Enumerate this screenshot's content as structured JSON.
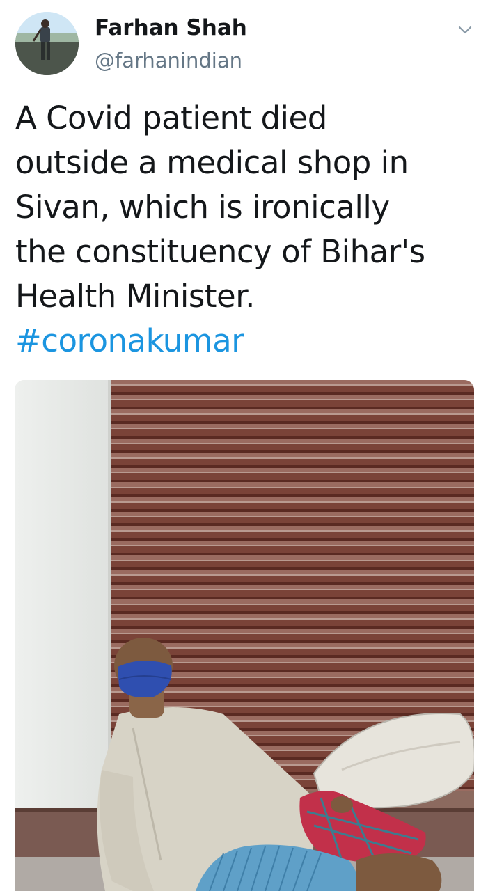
{
  "tweet": {
    "author": {
      "display_name": "Farhan Shah",
      "handle": "@farhanindian",
      "avatar_icon": "user-avatar"
    },
    "menu_icon": "chevron-down-icon",
    "text_lines": [
      "A Covid patient died",
      "outside a medical shop in",
      "Sivan, which is ironically",
      "the constituency of Bihar's",
      "Health Minister."
    ],
    "hashtag": "#coronakumar",
    "media": {
      "type": "photo",
      "icon": "photo-attachment"
    }
  },
  "colors": {
    "text": "#14171a",
    "secondary": "#657786",
    "link": "#1b95e0",
    "chevron": "#8899a6"
  }
}
